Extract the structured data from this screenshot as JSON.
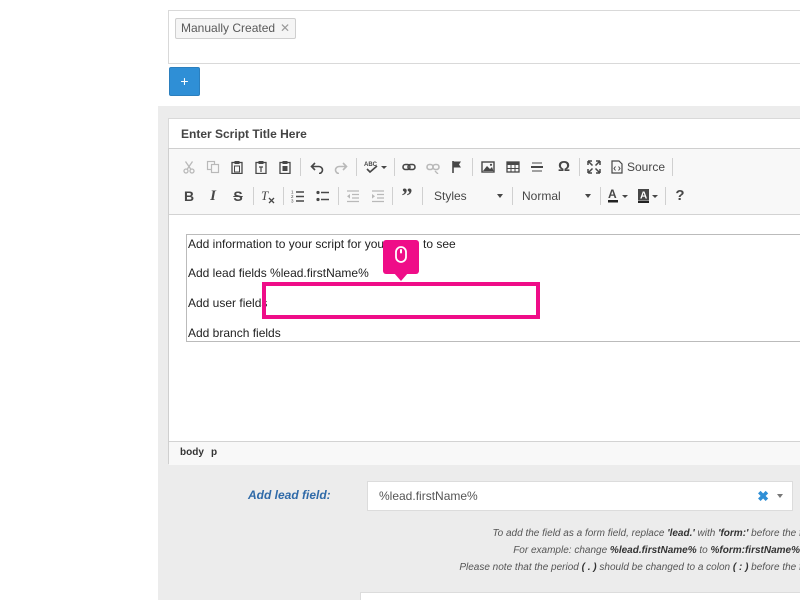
{
  "tags": {
    "items": [
      {
        "label": "Manually Created",
        "remove": "✕"
      }
    ]
  },
  "add_button": {
    "label": "+"
  },
  "script": {
    "title_placeholder": "Enter Script Title Here"
  },
  "toolbar": {
    "source_label": "Source",
    "styles_label": "Styles",
    "format_label": "Normal",
    "icons": [
      "cut-icon",
      "copy-icon",
      "paste-icon",
      "paste-text-icon",
      "paste-word-icon",
      "undo-icon",
      "redo-icon",
      "spellcheck-icon",
      "link-icon",
      "unlink-icon",
      "anchor-icon",
      "image-icon",
      "table-icon",
      "horizontal-line-icon",
      "special-char-icon",
      "maximize-icon",
      "source-icon",
      "bold-icon",
      "italic-icon",
      "strike-icon",
      "remove-format-icon",
      "numbered-list-icon",
      "bulleted-list-icon",
      "outdent-icon",
      "indent-icon",
      "blockquote-icon",
      "text-color-icon",
      "bg-color-icon",
      "help-icon"
    ]
  },
  "document": {
    "lines": [
      "Add information to your script for your",
      "to see",
      "Add lead fields %lead.firstName%",
      "Add user fields",
      "Add branch fields"
    ]
  },
  "pathbar": {
    "items": [
      "body",
      "p"
    ]
  },
  "lead_field": {
    "label": "Add lead field:",
    "value": "%lead.firstName%",
    "clear": "✖"
  },
  "help": {
    "line1_prefix": "To add the field as a form field, replace ",
    "line1_lead": "'lead.'",
    "line1_mid": " with ",
    "line1_form": "'form:'",
    "line1_suffix": " before the fi",
    "line2_prefix": "For example: change ",
    "line2_from": "%lead.firstName%",
    "line2_mid": " to ",
    "line2_to": "%form:firstName%",
    "line3_prefix": "Please note that the period ",
    "line3_period": "( . )",
    "line3_mid": " should be changed to a colon ",
    "line3_colon": "( : )",
    "line3_suffix": " before the fi"
  },
  "colors": {
    "accent": "#2f8fd6",
    "highlight": "#ef0d88",
    "label": "#2f6aa8"
  }
}
